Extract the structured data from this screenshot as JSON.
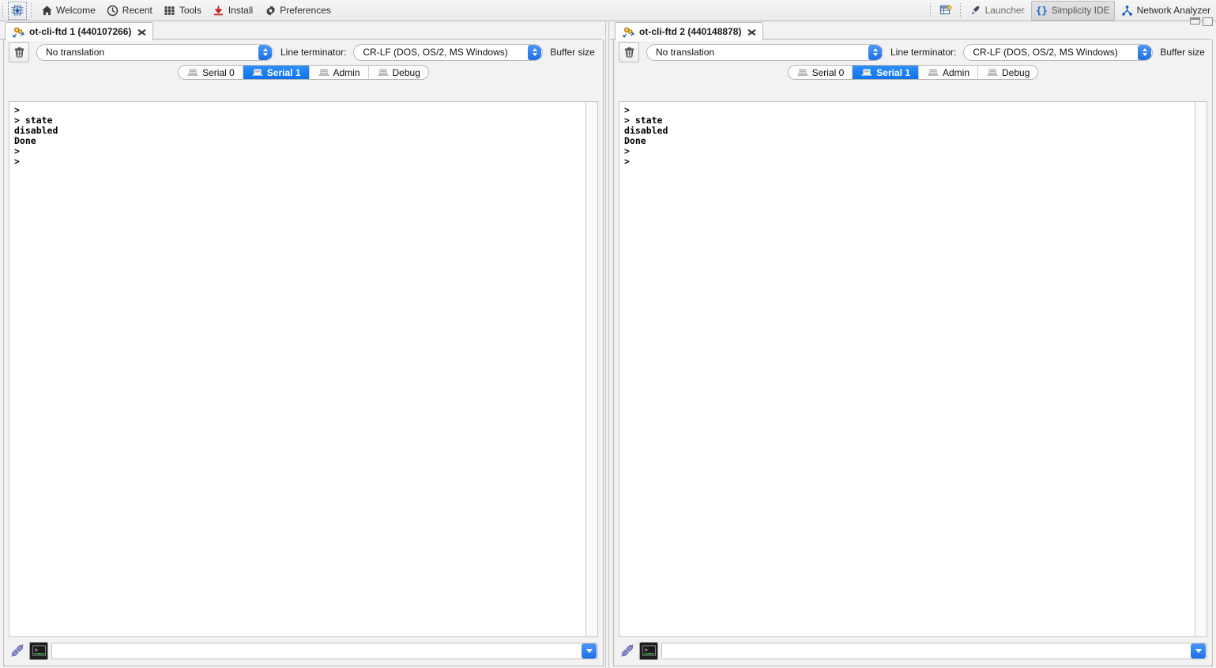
{
  "toolbar": {
    "chip_icon": "chip-download-icon",
    "items": [
      {
        "label": "Welcome",
        "icon": "home-icon",
        "selected": false
      },
      {
        "label": "Recent",
        "icon": "clock-icon",
        "selected": false
      },
      {
        "label": "Tools",
        "icon": "grid-icon",
        "selected": false
      },
      {
        "label": "Install",
        "icon": "download-icon",
        "selected": false
      },
      {
        "label": "Preferences",
        "icon": "gear-icon",
        "selected": false
      }
    ],
    "perspectives": [
      {
        "label": "Launcher",
        "icon": "rocket-icon",
        "selected": false
      },
      {
        "label": "Simplicity IDE",
        "icon": "braces-icon",
        "selected": true
      },
      {
        "label": "Network Analyzer",
        "icon": "network-icon",
        "selected": false
      }
    ],
    "new_perspective_icon": "new-perspective-icon",
    "window_controls": [
      "minimize-icon",
      "maximize-icon"
    ]
  },
  "panes": [
    {
      "tab_title": "ot-cli-ftd 1 (440107266)",
      "tab_icon": "serial-console-icon",
      "close_icon": "close-icon",
      "clear_icon": "trash-icon",
      "translation": {
        "value": "No translation"
      },
      "line_terminator": {
        "label": "Line terminator:",
        "value": "CR-LF  (DOS, OS/2, MS Windows)"
      },
      "buffer_size_label": "Buffer size",
      "serial_tabs": [
        {
          "label": "Serial 0",
          "icon": "keyboard-icon",
          "active": false
        },
        {
          "label": "Serial 1",
          "icon": "keyboard-icon",
          "active": true
        },
        {
          "label": "Admin",
          "icon": "keyboard-icon",
          "active": false
        },
        {
          "label": "Debug",
          "icon": "keyboard-icon",
          "active": false
        }
      ],
      "terminal_text": ">\n> state\ndisabled\nDone\n>\n>",
      "input": {
        "value": "",
        "placeholder": ""
      },
      "disconnect_icon": "plug-disconnect-icon",
      "console_icon": "terminal-icon",
      "history_icon": "chevron-down-icon"
    },
    {
      "tab_title": "ot-cli-ftd 2 (440148878)",
      "tab_icon": "serial-console-icon",
      "close_icon": "close-icon",
      "clear_icon": "trash-icon",
      "translation": {
        "value": "No translation"
      },
      "line_terminator": {
        "label": "Line terminator:",
        "value": "CR-LF  (DOS, OS/2, MS Windows)"
      },
      "buffer_size_label": "Buffer size",
      "serial_tabs": [
        {
          "label": "Serial 0",
          "icon": "keyboard-icon",
          "active": false
        },
        {
          "label": "Serial 1",
          "icon": "keyboard-icon",
          "active": true
        },
        {
          "label": "Admin",
          "icon": "keyboard-icon",
          "active": false
        },
        {
          "label": "Debug",
          "icon": "keyboard-icon",
          "active": false
        }
      ],
      "terminal_text": ">\n> state\ndisabled\nDone\n>\n>",
      "input": {
        "value": "",
        "placeholder": ""
      },
      "disconnect_icon": "plug-disconnect-icon",
      "console_icon": "terminal-icon",
      "history_icon": "chevron-down-icon"
    }
  ],
  "colors": {
    "accent_blue": "#0c73ef",
    "toolbar_bg": "#efefef",
    "panel_bg": "#f2f2f2",
    "terminal_bg": "#ffffff",
    "border": "#b9b9b9"
  }
}
